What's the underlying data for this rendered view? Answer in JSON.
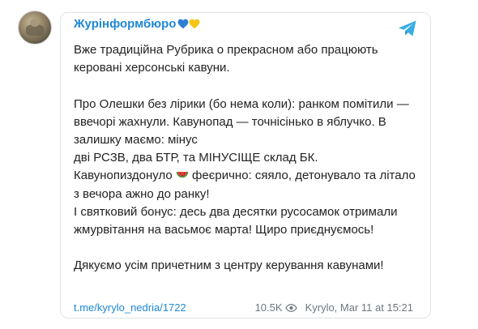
{
  "channel": {
    "name": "Журінформбюро",
    "avatar": "channel-avatar"
  },
  "post": {
    "line_1": "Вже традиційна Рубрика о прекрасном або працюють керовані херсонські кавуни.",
    "line_2": "Про Олешки без лірики (бо нема коли): ранком помітили — ввечорі жахнули. Кавунопад — точнісінько в яблучко. В залишку маємо: мінус",
    "line_3": "дві РСЗВ, два БТР, та МІНУСІЩЕ склад БК.",
    "line_4a": "Кавунопиздонуло",
    "line_4b": " феєрично: сяяло, детонувало та літало з вечора ажно до ранку!",
    "line_5": "І святковий бонус: десь два десятки русосамок отримали жмурвітання на васьмоє марта! Щиро приєднуємось!",
    "line_6": "Дякуємо усім причетним з центру керування кавунами!"
  },
  "footer": {
    "link": "t.me/kyrylo_nedria/1722",
    "views": "10.5K",
    "author_date": "Kyrylo, Mar 11 at 15:21"
  },
  "icons": {
    "hearts": [
      "blue-heart",
      "yellow-heart"
    ],
    "emoji": "watermelon",
    "logo": "telegram-logo",
    "views": "eye-icon"
  },
  "colors": {
    "accent": "#1f88d4",
    "text": "#222222",
    "muted": "#6e7881",
    "telegram": "#37aee2",
    "heart_blue": "#2e7fd6",
    "heart_yellow": "#f5c518"
  }
}
